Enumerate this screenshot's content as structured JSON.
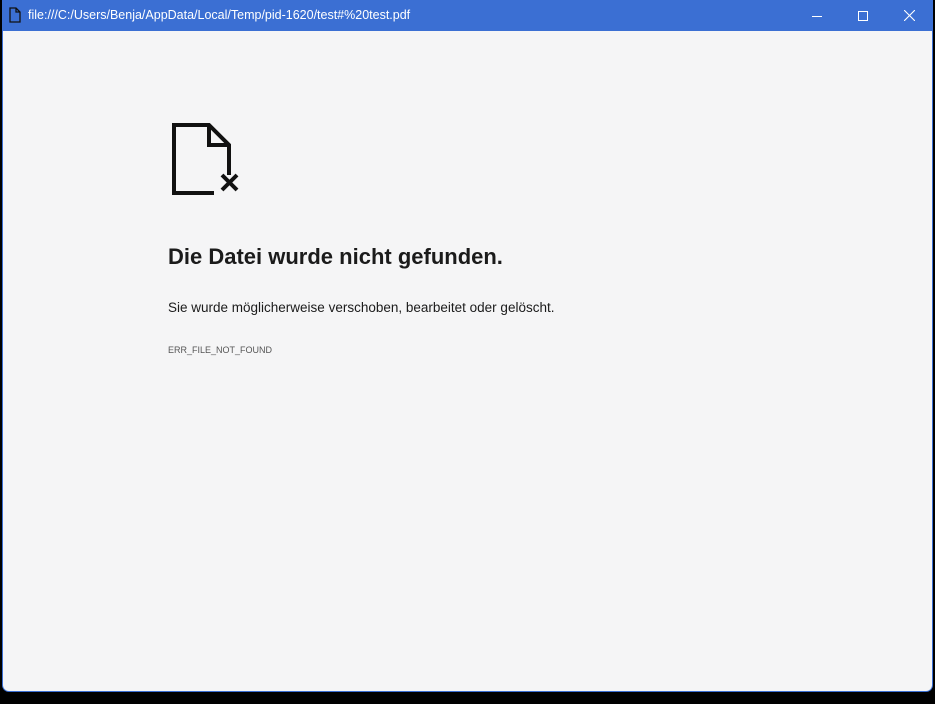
{
  "window": {
    "title": "file:///C:/Users/Benja/AppData/Local/Temp/pid-1620/test#%20test.pdf",
    "title_bar_color": "#3b6fd3"
  },
  "error": {
    "icon": "file-not-found-icon",
    "heading": "Die Datei wurde nicht gefunden.",
    "message": "Sie wurde möglicherweise verschoben, bearbeitet oder gelöscht.",
    "code": "ERR_FILE_NOT_FOUND"
  }
}
